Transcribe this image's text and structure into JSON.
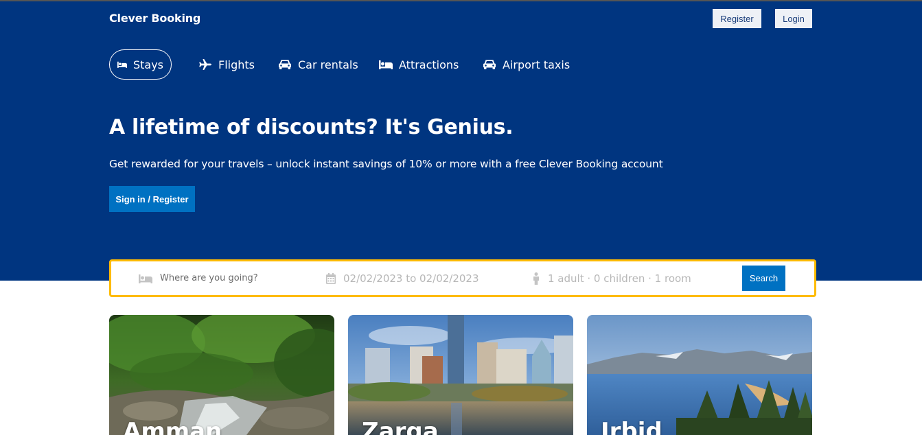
{
  "header": {
    "brand": "Clever Booking",
    "register_label": "Register",
    "login_label": "Login"
  },
  "nav": {
    "items": [
      {
        "label": "Stays",
        "icon": "bed-icon",
        "active": true
      },
      {
        "label": "Flights",
        "icon": "plane-icon",
        "active": false
      },
      {
        "label": "Car rentals",
        "icon": "car-icon",
        "active": false
      },
      {
        "label": "Attractions",
        "icon": "bed-icon",
        "active": false
      },
      {
        "label": "Airport taxis",
        "icon": "car-icon",
        "active": false
      }
    ]
  },
  "hero": {
    "headline": "A lifetime of discounts? It's Genius.",
    "subline": "Get rewarded for your travels – unlock instant savings of 10% or more with a free Clever Booking account",
    "cta_label": "Sign in / Register"
  },
  "search": {
    "destination_placeholder": "Where are you going?",
    "dates": "02/02/2023 to 02/02/2023",
    "guests": "1 adult · 0 children · 1 room",
    "button_label": "Search"
  },
  "destinations": [
    {
      "name": "Amman"
    },
    {
      "name": "Zarqa"
    },
    {
      "name": "Irbid"
    }
  ],
  "colors": {
    "hero_bg": "#003580",
    "accent_blue": "#0071c2",
    "search_border": "#febb02"
  }
}
